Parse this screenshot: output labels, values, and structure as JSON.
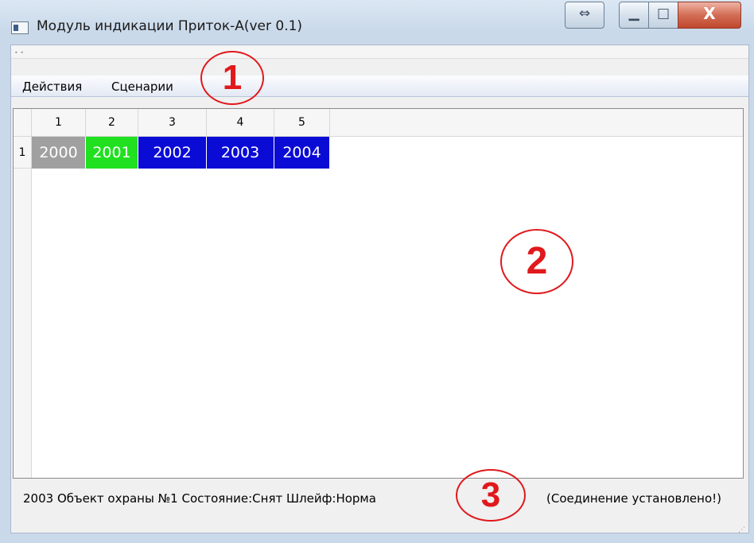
{
  "window": {
    "title": "Модуль индикации Приток-А(ver 0.1)",
    "buttons": {
      "resize": "⇔",
      "minimize": "▁",
      "maximize": "□",
      "close": "X"
    }
  },
  "menu": {
    "items": [
      {
        "label": "Действия"
      },
      {
        "label": "Сценарии"
      }
    ]
  },
  "table": {
    "columns": [
      "1",
      "2",
      "3",
      "4",
      "5"
    ],
    "rows": [
      {
        "header": "1",
        "cells": [
          {
            "value": "2000",
            "color": "#a0a0a0"
          },
          {
            "value": "2001",
            "color": "#20e020"
          },
          {
            "value": "2002",
            "color": "#0b0bd6"
          },
          {
            "value": "2003",
            "color": "#0b0bd6"
          },
          {
            "value": "2004",
            "color": "#0b0bd6"
          }
        ]
      }
    ]
  },
  "statusbar": {
    "left": "2003 Объект охраны №1 Состояние:Снят Шлейф:Норма",
    "right": "(Соединение установлено!)"
  },
  "callouts": [
    "1",
    "2",
    "3"
  ],
  "accent_color": "#e0191c"
}
